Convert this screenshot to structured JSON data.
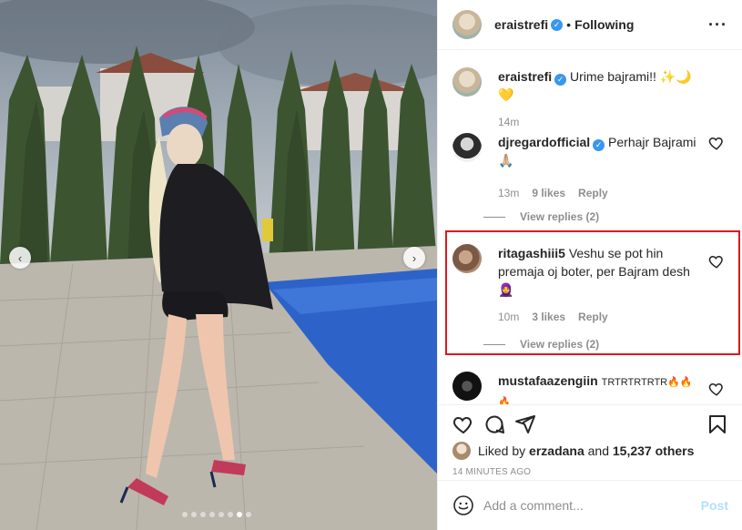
{
  "post": {
    "image_alt": "Photo of a woman standing beside a swimming pool",
    "carousel": {
      "total": 8,
      "active_index": 6
    },
    "prev_arrow": "‹",
    "next_arrow": "›"
  },
  "header": {
    "username": "eraistrefi",
    "separator": "•",
    "follow_status": "Following",
    "more_icon": "···"
  },
  "comments": [
    {
      "username": "eraistrefi",
      "verified": true,
      "text": "Urime bajrami!! ✨🌙💛",
      "time": "14m",
      "likes": "",
      "reply": "",
      "view_replies": ""
    },
    {
      "username": "djregardofficial",
      "verified": true,
      "text": "Perhajr Bajrami 🙏🏼",
      "time": "13m",
      "likes": "9 likes",
      "reply": "Reply",
      "view_replies": "View replies (2)"
    },
    {
      "username": "ritagashiii5",
      "verified": false,
      "text": "Veshu se pot hin premaja oj boter, per Bajram desh 🧕",
      "time": "10m",
      "likes": "3 likes",
      "reply": "Reply",
      "view_replies": "View replies (2)"
    },
    {
      "username": "mustafaazengiin",
      "verified": false,
      "text": "TRTRTRTRTR🔥🔥🔥",
      "time": "",
      "likes": "",
      "reply": "",
      "view_replies": ""
    }
  ],
  "actions": {
    "liked_by_prefix": "Liked by ",
    "liked_by_user": "erzadana",
    "and_text": " and ",
    "others_count": "15,237 others",
    "timestamp": "14 MINUTES AGO"
  },
  "add_comment": {
    "placeholder": "Add a comment...",
    "post_label": "Post"
  },
  "colors": {
    "verified": "#3897f0",
    "highlight_border": "#e0171c",
    "post_button_disabled": "#b2dffc",
    "muted_text": "#8e8e8e"
  },
  "icons": [
    "heart-icon",
    "comment-icon",
    "share-icon",
    "bookmark-icon",
    "emoji-icon",
    "verified-badge-icon",
    "more-options-icon",
    "chevron-left-icon",
    "chevron-right-icon"
  ]
}
